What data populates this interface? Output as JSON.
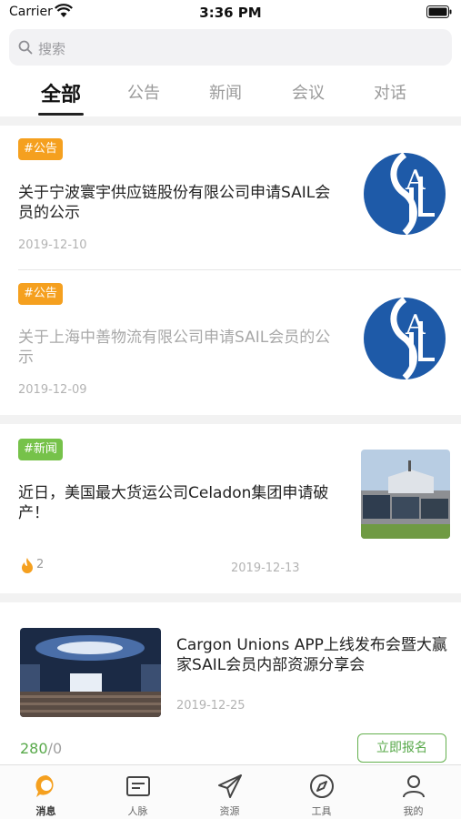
{
  "status": {
    "carrier": "Carrier",
    "time": "3:36 PM"
  },
  "search": {
    "placeholder": "搜索"
  },
  "tabs": [
    {
      "label": "全部",
      "active": true
    },
    {
      "label": "公告"
    },
    {
      "label": "新闻"
    },
    {
      "label": "会议"
    },
    {
      "label": "对话"
    }
  ],
  "feed": [
    {
      "tag": "#公告",
      "title": "关于宁波寰宇供应链股份有限公司申请SAIL会员的公示",
      "date": "2019-12-10",
      "image": "sail-logo"
    },
    {
      "tag": "#公告",
      "title": "关于上海中善物流有限公司申请SAIL会员的公示",
      "date": "2019-12-09",
      "image": "sail-logo",
      "read": true
    },
    {
      "tag": "#新闻",
      "title": "近日，美国最大货运公司Celadon集团申请破产！",
      "date": "2019-12-13",
      "hot_count": "2",
      "image": "truck-photo"
    },
    {
      "title": "Cargon Unions APP上线发布会暨大赢家SAIL会员内部资源分享会",
      "date": "2019-12-25",
      "signup_count": "280",
      "signup_total": "/0",
      "button": "立即报名",
      "image": "conference-hall-photo"
    }
  ],
  "tabbar": [
    {
      "label": "消息",
      "icon": "message-icon",
      "active": true
    },
    {
      "label": "人脉",
      "icon": "contacts-card-icon"
    },
    {
      "label": "资源",
      "icon": "paper-plane-icon"
    },
    {
      "label": "工具",
      "icon": "compass-icon"
    },
    {
      "label": "我的",
      "icon": "user-icon"
    }
  ],
  "colors": {
    "notice_tag": "#f5a01f",
    "news_tag": "#76c24a",
    "accent_green": "#58a94a",
    "active_tab_icon": "#f5a01f",
    "sail_blue": "#1e5aa8"
  }
}
